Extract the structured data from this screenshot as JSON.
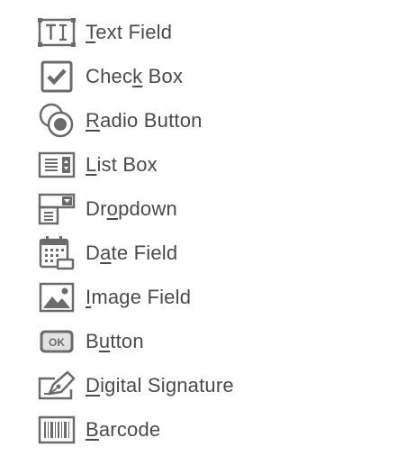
{
  "menu": {
    "items": [
      {
        "id": "text-field",
        "pre": "",
        "mn": "T",
        "post": "ext Field",
        "icon": "text-field-icon"
      },
      {
        "id": "check-box",
        "pre": "Chec",
        "mn": "k",
        "post": " Box",
        "icon": "check-box-icon"
      },
      {
        "id": "radio-button",
        "pre": "",
        "mn": "R",
        "post": "adio Button",
        "icon": "radio-button-icon"
      },
      {
        "id": "list-box",
        "pre": "",
        "mn": "L",
        "post": "ist Box",
        "icon": "list-box-icon"
      },
      {
        "id": "dropdown",
        "pre": "Dr",
        "mn": "o",
        "post": "pdown",
        "icon": "dropdown-icon"
      },
      {
        "id": "date-field",
        "pre": "D",
        "mn": "a",
        "post": "te Field",
        "icon": "calendar-icon"
      },
      {
        "id": "image-field",
        "pre": "",
        "mn": "I",
        "post": "mage Field",
        "icon": "image-icon"
      },
      {
        "id": "button",
        "pre": "B",
        "mn": "u",
        "post": "tton",
        "icon": "ok-button-icon"
      },
      {
        "id": "digital-signature",
        "pre": "",
        "mn": "D",
        "post": "igital Signature",
        "icon": "signature-pen-icon"
      },
      {
        "id": "barcode",
        "pre": "",
        "mn": "B",
        "post": "arcode",
        "icon": "barcode-icon"
      }
    ],
    "ok_icon_text": "OK"
  },
  "colors": {
    "icon": "#6b6b6b",
    "text": "#4a4a4a",
    "background": "#ffffff"
  }
}
